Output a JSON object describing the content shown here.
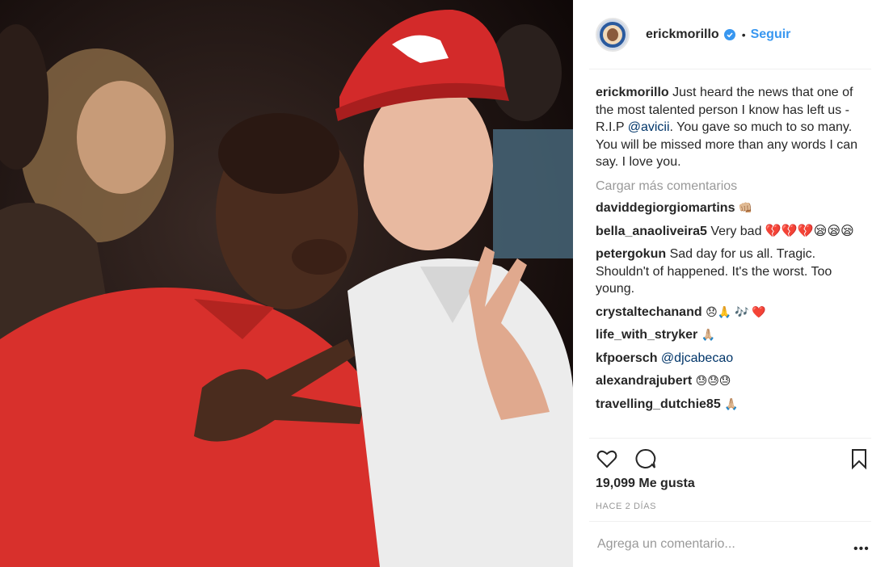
{
  "post": {
    "username": "erickmorillo",
    "follow_label": "Seguir",
    "separator": "•",
    "verified": true,
    "avatar_icon": "profile-avatar",
    "caption": {
      "author": "erickmorillo",
      "text_before": "Just heard the news that one of the most talented person I know has left us - R.I.P",
      "mention": "@avicii",
      "text_after": ". You gave so much to so many. You will be missed more than any words I can say. I love you."
    },
    "load_more_label": "Cargar más comentarios",
    "comments": [
      {
        "user": "daviddegiorgiomartins",
        "text": "👊🏼"
      },
      {
        "user": "bella_anaoliveira5",
        "text": "Very bad 💔💔💔😪😪😪"
      },
      {
        "user": "petergokun",
        "text": "Sad day for us all. Tragic. Shouldn't of happened. It's the worst. Too young."
      },
      {
        "user": "crystaltechanand",
        "text": "😞🙏 🎶 ❤️"
      },
      {
        "user": "life_with_stryker",
        "text": "🙏🏼"
      },
      {
        "user": "kfpoersch",
        "mention": "@djcabecao"
      },
      {
        "user": "alexandrajubert",
        "text": "😓😓😓"
      },
      {
        "user": "travelling_dutchie85",
        "text": "🙏🏼"
      }
    ],
    "likes_label": "19,099 Me gusta",
    "time_label": "HACE 2 DÍAS",
    "add_comment_placeholder": "Agrega un comentario...",
    "more_options": "•••",
    "colors": {
      "link": "#3897f0",
      "mention": "#003569",
      "muted": "#999999",
      "text": "#262626"
    }
  }
}
